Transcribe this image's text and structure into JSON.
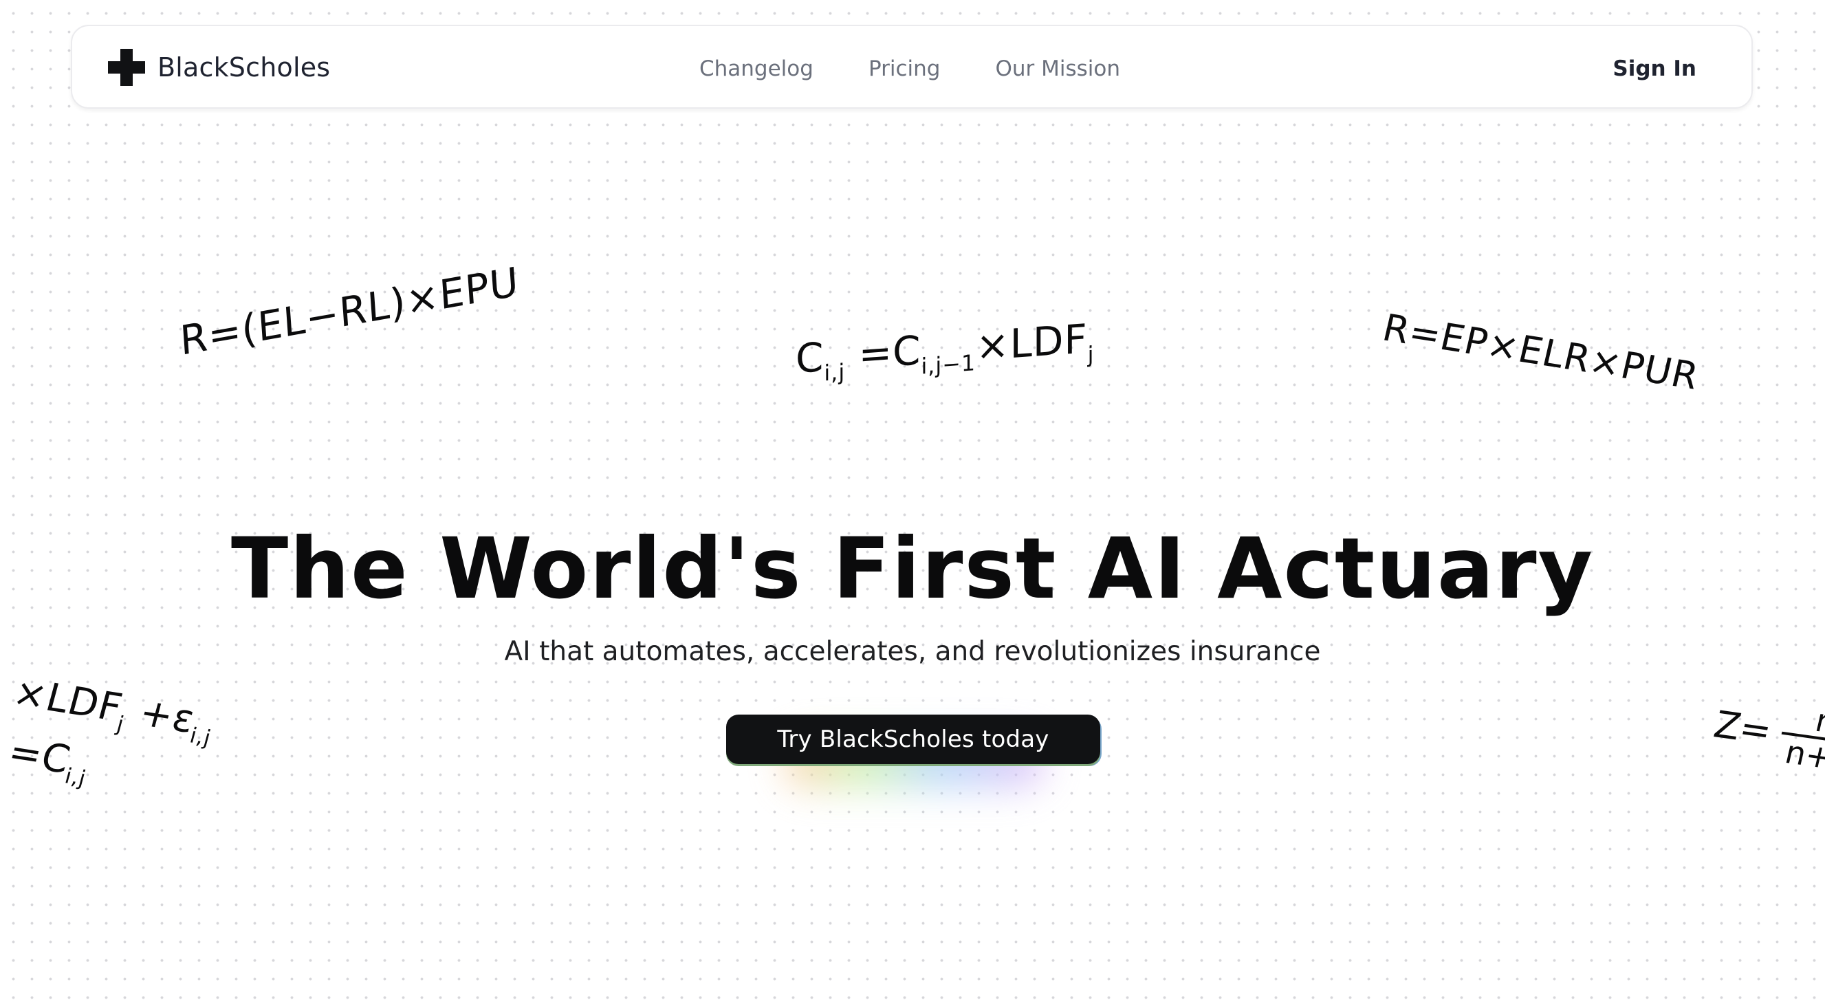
{
  "brand": {
    "name": "BlackScholes",
    "logo_icon": "four-square-cross-logo"
  },
  "nav": {
    "links": [
      {
        "label": "Changelog"
      },
      {
        "label": "Pricing"
      },
      {
        "label": "Our Mission"
      }
    ],
    "sign_in": "Sign In"
  },
  "formulas": {
    "f1": "R=(EL−RL)×EPU",
    "f2": {
      "main": "C",
      "sub1": "i,j",
      "eq": " =C",
      "sub2": "i,j−1",
      "rest": "×LDF",
      "sub3": "j"
    },
    "f3": "R=EP×ELR×PUR",
    "f4": {
      "lead": "ı ×LDF",
      "sub1": "j",
      "mid": " +ε",
      "sub2": "i,j"
    },
    "f5": {
      "main": "=C",
      "sub1": "i,j"
    },
    "f6": {
      "lhs": "Z=",
      "numerator": "n",
      "denominator": "n+k"
    }
  },
  "hero": {
    "title": "The World's First AI Actuary",
    "subtitle": "AI that automates, accelerates, and revolutionizes insurance",
    "cta": "Try BlackScholes today"
  },
  "colors": {
    "background": "#ffffff",
    "grid_dot": "#d6d6da",
    "text_primary": "#0b0b0c",
    "nav_link": "#6b707c",
    "cta_background": "#111214"
  }
}
